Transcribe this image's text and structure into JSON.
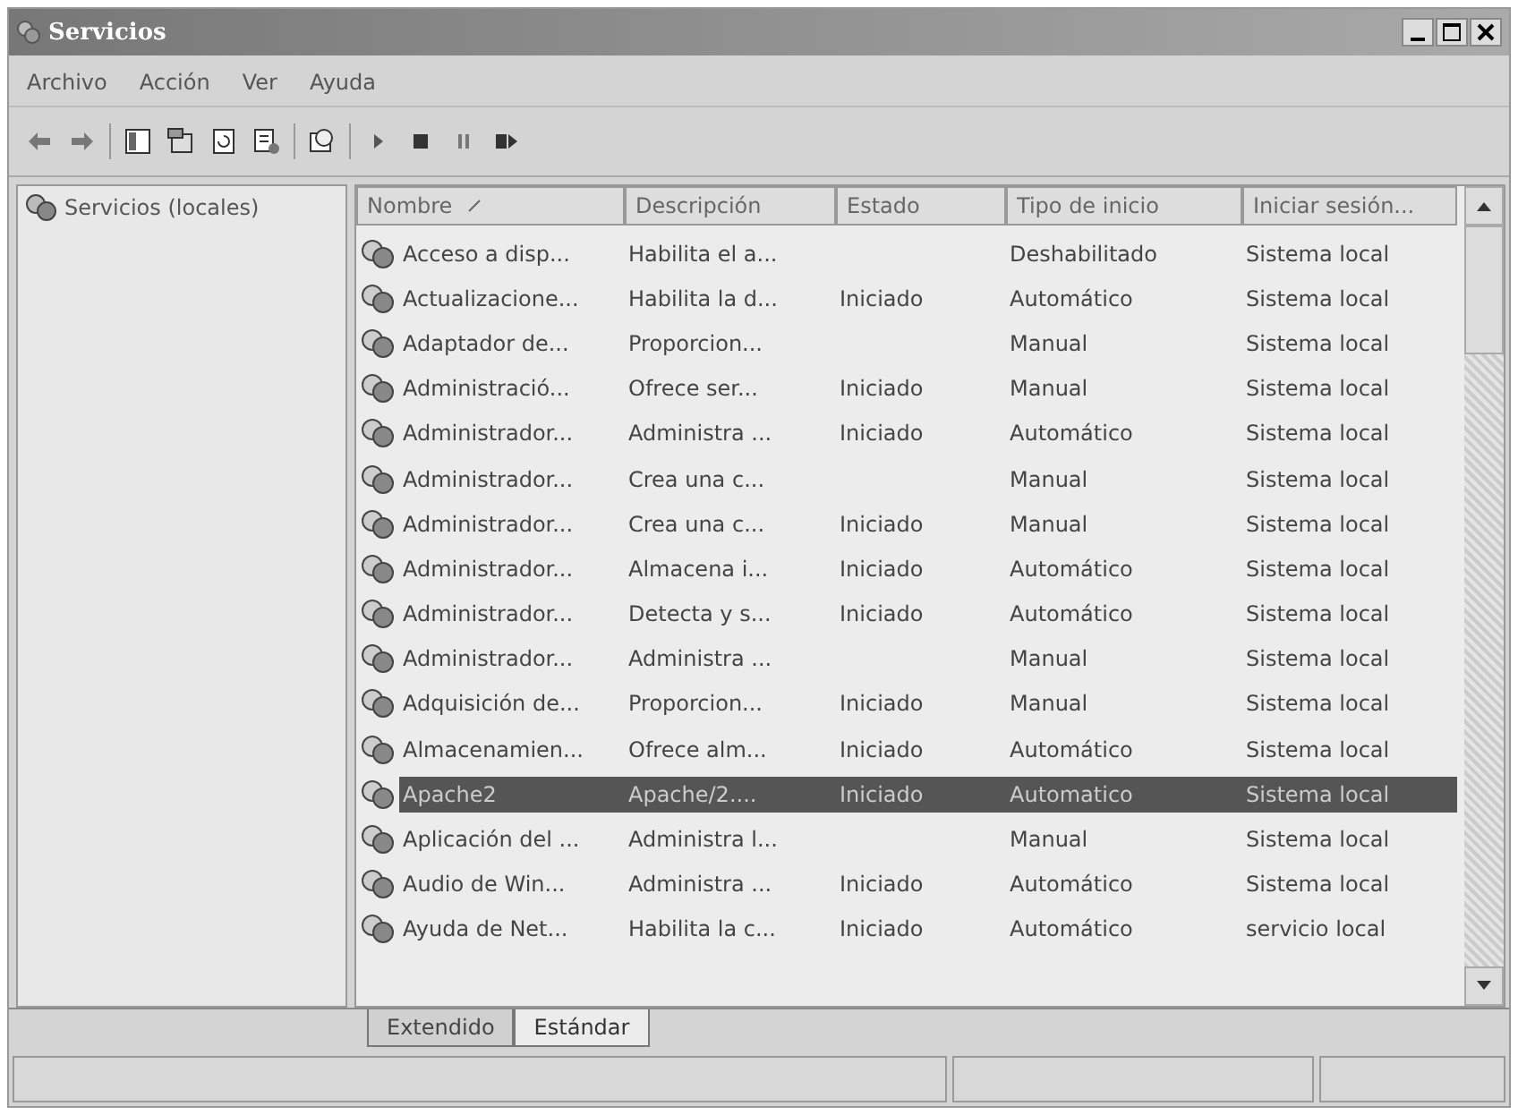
{
  "window": {
    "title": "Servicios"
  },
  "menu": [
    "Archivo",
    "Acción",
    "Ver",
    "Ayuda"
  ],
  "tree": {
    "label": "Servicios (locales)",
    "selected": false
  },
  "table": {
    "columns": [
      {
        "label": "Nombre",
        "sorted": true
      },
      {
        "label": "Descripción",
        "sorted": false
      },
      {
        "label": "Estado",
        "sorted": false
      },
      {
        "label": "Tipo de inicio",
        "sorted": false
      },
      {
        "label": "Iniciar sesión...",
        "sorted": false
      }
    ],
    "rows": [
      {
        "cells": [
          "Acceso a disp...",
          "Habilita el a...",
          "",
          "Deshabilitado",
          "Sistema local"
        ],
        "selected": false
      },
      {
        "cells": [
          "Actualizacione...",
          "Habilita la d...",
          "Iniciado",
          "Automático",
          "Sistema local"
        ],
        "selected": false
      },
      {
        "cells": [
          "Adaptador de...",
          "Proporcion...",
          "",
          "Manual",
          "Sistema local"
        ],
        "selected": false
      },
      {
        "cells": [
          "Administració...",
          "Ofrece ser...",
          "Iniciado",
          "Manual",
          "Sistema local"
        ],
        "selected": false
      },
      {
        "cells": [
          "Administrador...",
          "Administra ...",
          "Iniciado",
          "Automático",
          "Sistema local"
        ],
        "selected": false
      },
      {
        "cells": [
          "Administrador...",
          "Crea una c...",
          "",
          "Manual",
          "Sistema local"
        ],
        "selected": false
      },
      {
        "cells": [
          "Administrador...",
          "Crea una c...",
          "Iniciado",
          "Manual",
          "Sistema local"
        ],
        "selected": false
      },
      {
        "cells": [
          "Administrador...",
          "Almacena i...",
          "Iniciado",
          "Automático",
          "Sistema local"
        ],
        "selected": false
      },
      {
        "cells": [
          "Administrador...",
          "Detecta y s...",
          "Iniciado",
          "Automático",
          "Sistema local"
        ],
        "selected": false
      },
      {
        "cells": [
          "Administrador...",
          "Administra ...",
          "",
          "Manual",
          "Sistema local"
        ],
        "selected": false
      },
      {
        "cells": [
          "Adquisición de...",
          "Proporcion...",
          "Iniciado",
          "Manual",
          "Sistema local"
        ],
        "selected": false
      },
      {
        "cells": [
          "Almacenamien...",
          "Ofrece alm...",
          "Iniciado",
          "Automático",
          "Sistema local"
        ],
        "selected": false
      },
      {
        "cells": [
          "Apache2",
          "Apache/2....",
          "Iniciado",
          "Automatico",
          "Sistema local"
        ],
        "selected": true
      },
      {
        "cells": [
          "Aplicación del ...",
          "Administra l...",
          "",
          "Manual",
          "Sistema local"
        ],
        "selected": false
      },
      {
        "cells": [
          "Audio de Win...",
          "Administra ...",
          "Iniciado",
          "Automático",
          "Sistema local"
        ],
        "selected": false
      },
      {
        "cells": [
          "Ayuda de Net...",
          "Habilita la c...",
          "Iniciado",
          "Automático",
          "servicio local"
        ],
        "selected": false
      }
    ]
  },
  "view_tabs": [
    {
      "label": "Extendido",
      "selected": false
    },
    {
      "label": "Estándar",
      "selected": true
    }
  ]
}
